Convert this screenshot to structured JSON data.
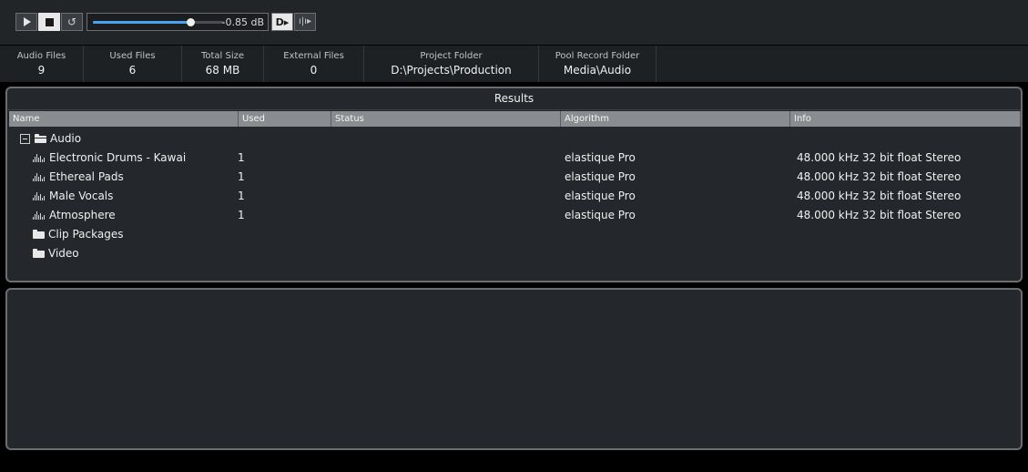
{
  "transport": {
    "volume_label": "-0.85 dB",
    "volume_level": 0.74
  },
  "stats": [
    {
      "label": "Audio Files",
      "value": "9"
    },
    {
      "label": "Used Files",
      "value": "6"
    },
    {
      "label": "Total Size",
      "value": "68 MB"
    },
    {
      "label": "External Files",
      "value": "0"
    },
    {
      "label": "Project Folder",
      "value": "D:\\Projects\\Production"
    },
    {
      "label": "Pool Record Folder",
      "value": "Media\\Audio"
    }
  ],
  "results": {
    "title": "Results",
    "columns": [
      "Name",
      "Used",
      "Status",
      "Algorithm",
      "Info"
    ],
    "tree": {
      "audio_folder": "Audio",
      "clips": [
        {
          "name": "Electronic Drums - Kawai",
          "used": "1",
          "status": "",
          "algorithm": "elastique Pro",
          "info": "48.000 kHz 32 bit float Stereo"
        },
        {
          "name": "Ethereal Pads",
          "used": "1",
          "status": "",
          "algorithm": "elastique Pro",
          "info": "48.000 kHz 32 bit float Stereo"
        },
        {
          "name": "Male Vocals",
          "used": "1",
          "status": "",
          "algorithm": "elastique Pro",
          "info": "48.000 kHz 32 bit float Stereo"
        },
        {
          "name": "Atmosphere",
          "used": "1",
          "status": "",
          "algorithm": "elastique Pro",
          "info": "48.000 kHz 32 bit float Stereo"
        }
      ],
      "other_folders": [
        "Clip Packages",
        "Video"
      ]
    }
  },
  "colors": {
    "accent": "#4aa3f0",
    "panel_bg": "#24272b",
    "header_bg": "#8a8d90"
  }
}
